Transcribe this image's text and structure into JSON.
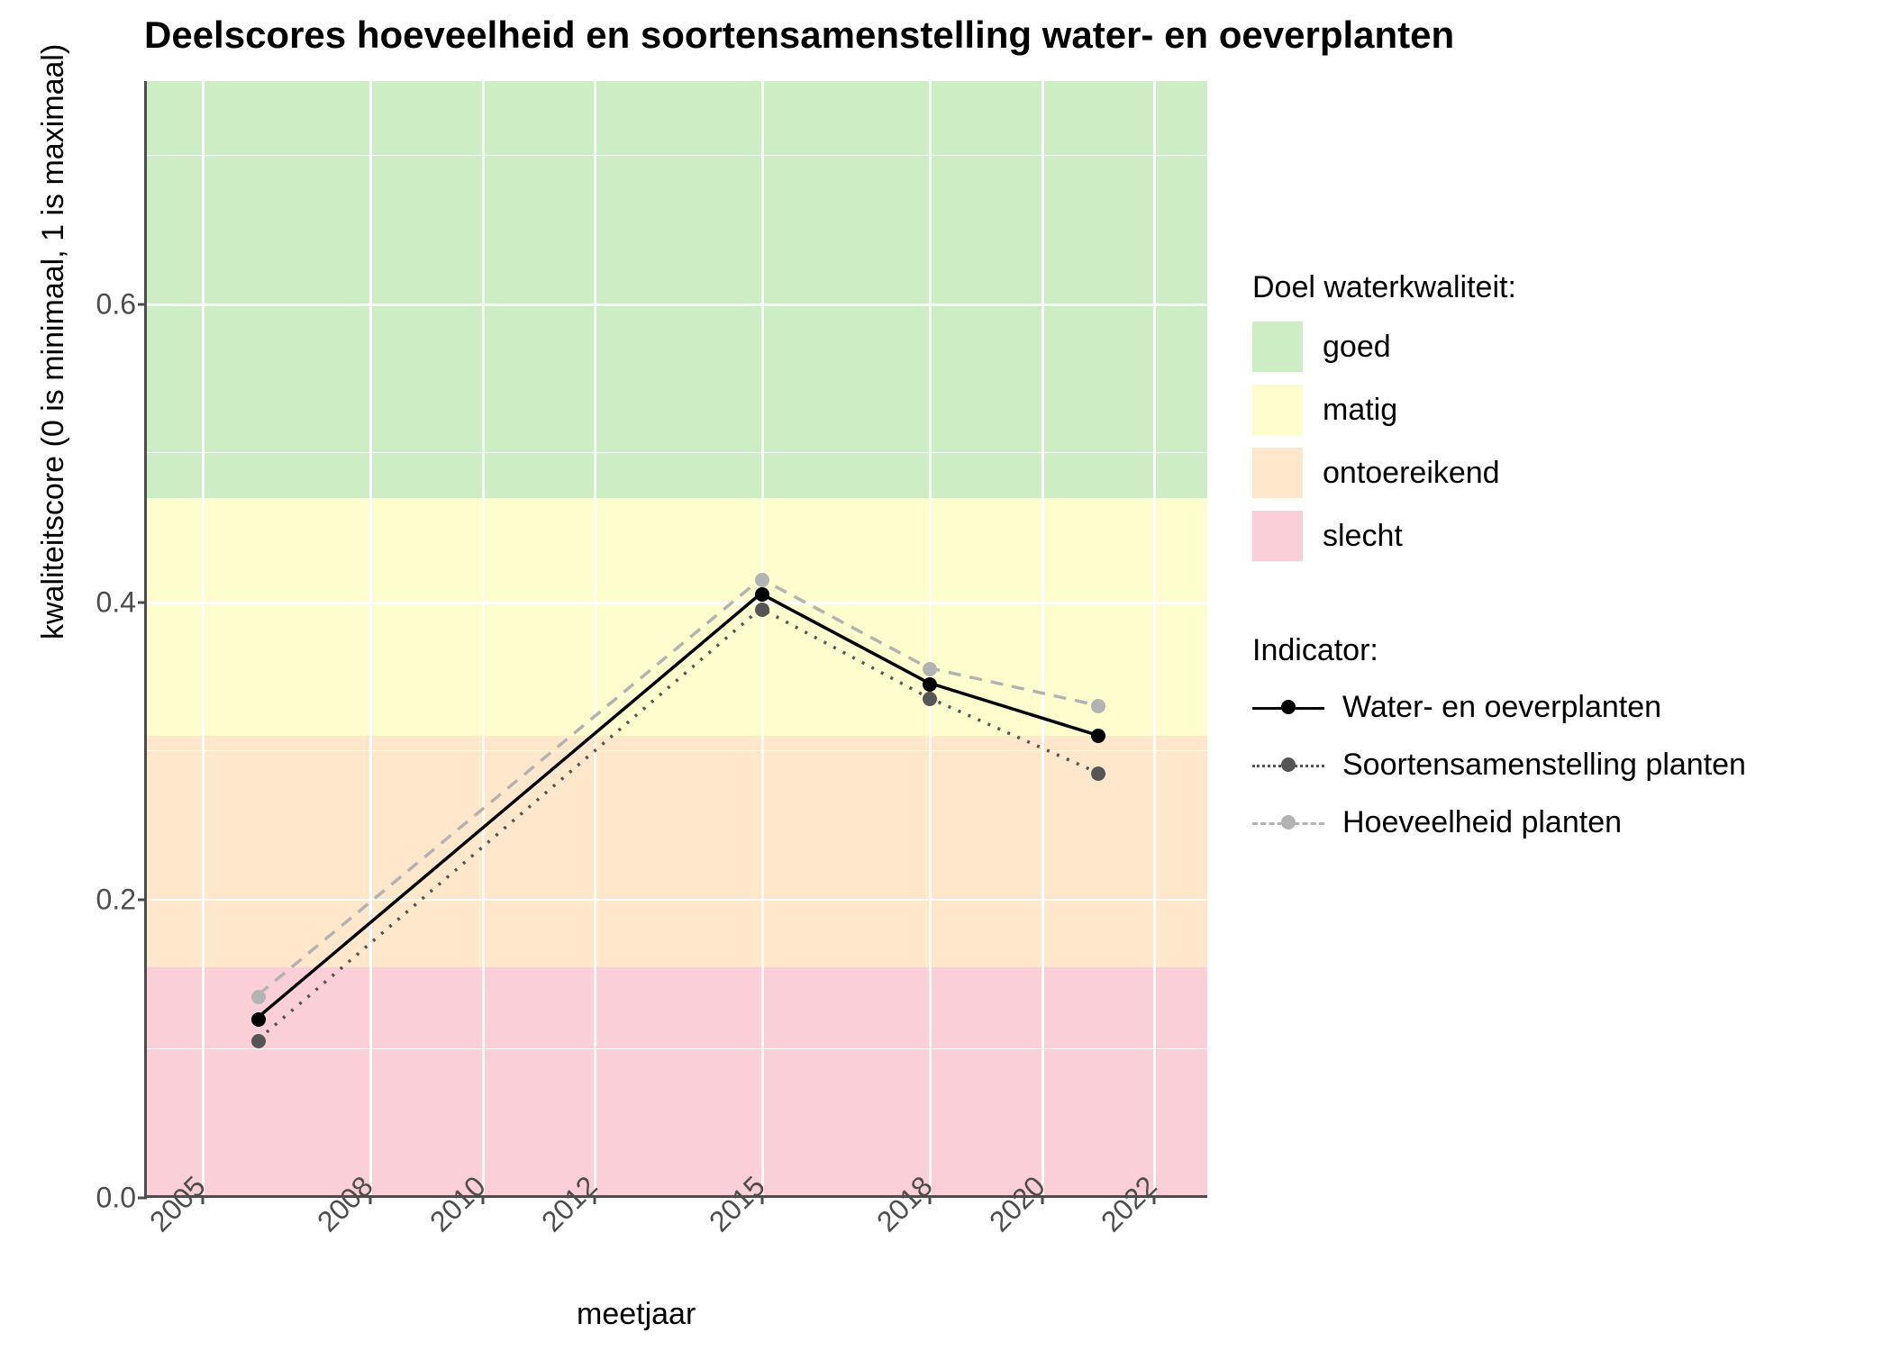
{
  "chart_data": {
    "type": "line",
    "title": "Deelscores hoeveelheid en soortensamenstelling water- en oeverplanten",
    "xlabel": "meetjaar",
    "ylabel": "kwaliteitscore (0 is minimaal, 1 is maximaal)",
    "x_ticks": [
      2005,
      2008,
      2010,
      2012,
      2015,
      2018,
      2020,
      2022
    ],
    "y_ticks": [
      0.0,
      0.2,
      0.4,
      0.6
    ],
    "xlim": [
      2004,
      2023
    ],
    "ylim": [
      0.0,
      0.75
    ],
    "x": [
      2006,
      2015,
      2018,
      2021
    ],
    "series": [
      {
        "name": "Water- en oeverplanten",
        "color": "#000000",
        "dash": "solid",
        "values": [
          0.12,
          0.405,
          0.345,
          0.31
        ]
      },
      {
        "name": "Soortensamenstelling planten",
        "color": "#555555",
        "dash": "dotted",
        "values": [
          0.105,
          0.395,
          0.335,
          0.285
        ]
      },
      {
        "name": "Hoeveelheid planten",
        "color": "#b3b3b3",
        "dash": "dashed",
        "values": [
          0.135,
          0.415,
          0.355,
          0.33
        ]
      }
    ],
    "bands": [
      {
        "name": "goed",
        "from": 0.47,
        "to": 0.75,
        "color": "#cdeec5"
      },
      {
        "name": "matig",
        "from": 0.31,
        "to": 0.47,
        "color": "#fefdcd"
      },
      {
        "name": "ontoereikend",
        "from": 0.155,
        "to": 0.31,
        "color": "#fee7cb"
      },
      {
        "name": "slecht",
        "from": 0.0,
        "to": 0.155,
        "color": "#fbcfd7"
      }
    ],
    "legend_band_title": "Doel waterkwaliteit:",
    "legend_series_title": "Indicator:"
  }
}
